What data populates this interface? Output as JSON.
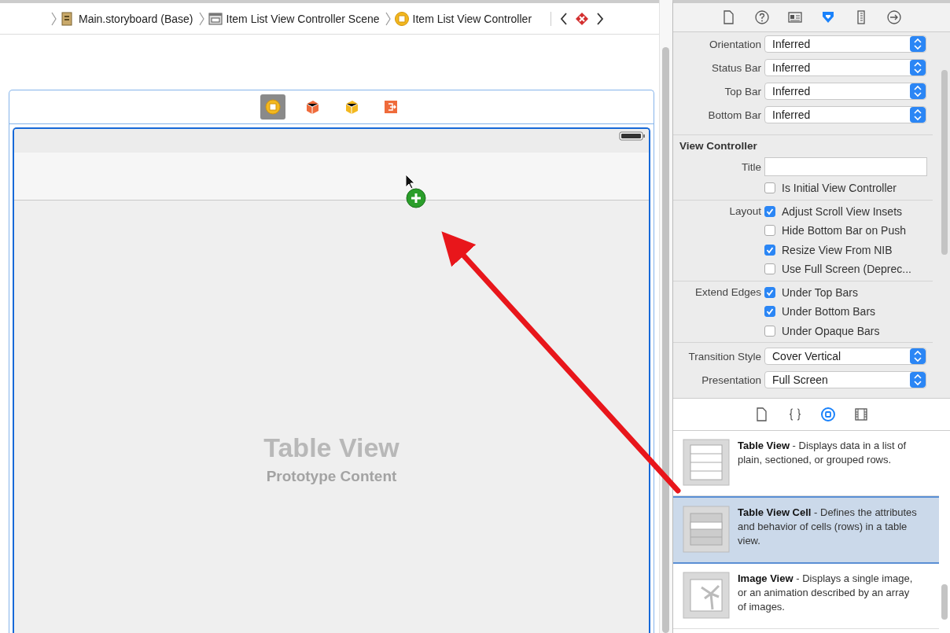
{
  "breadcrumbs": [
    {
      "label": "Main.storyboard (Base)",
      "kind": "storyboard"
    },
    {
      "label": "Item List View Controller Scene",
      "kind": "scene"
    },
    {
      "label": "Item List View Controller",
      "kind": "controller"
    }
  ],
  "scene_dock": [
    {
      "kind": "controller",
      "selected": true
    },
    {
      "kind": "first-responder",
      "selected": false
    },
    {
      "kind": "object",
      "selected": false
    },
    {
      "kind": "exit",
      "selected": false
    }
  ],
  "table_view": {
    "title": "Table View",
    "subtitle": "Prototype Content"
  },
  "inspector_tabs": [
    {
      "kind": "file",
      "selected": false
    },
    {
      "kind": "help",
      "selected": false
    },
    {
      "kind": "identity",
      "selected": false
    },
    {
      "kind": "attributes",
      "selected": true
    },
    {
      "kind": "size",
      "selected": false
    },
    {
      "kind": "connections",
      "selected": false
    }
  ],
  "bar_rows": [
    {
      "label": "Orientation",
      "value": "Inferred"
    },
    {
      "label": "Status Bar",
      "value": "Inferred"
    },
    {
      "label": "Top Bar",
      "value": "Inferred"
    },
    {
      "label": "Bottom Bar",
      "value": "Inferred"
    }
  ],
  "view_controller": {
    "heading": "View Controller",
    "title_label": "Title",
    "groups": [
      {
        "options": [
          {
            "label": "Is Initial View Controller",
            "checked": false
          }
        ]
      },
      {
        "label": "Layout",
        "options": [
          {
            "label": "Adjust Scroll View Insets",
            "checked": true
          },
          {
            "label": "Hide Bottom Bar on Push",
            "checked": false
          },
          {
            "label": "Resize View From NIB",
            "checked": true
          },
          {
            "label": "Use Full Screen (Deprec...",
            "checked": false
          }
        ]
      },
      {
        "label": "Extend Edges",
        "options": [
          {
            "label": "Under Top Bars",
            "checked": true
          },
          {
            "label": "Under Bottom Bars",
            "checked": true
          },
          {
            "label": "Under Opaque Bars",
            "checked": false
          }
        ]
      }
    ],
    "popups": [
      {
        "label": "Transition Style",
        "value": "Cover Vertical"
      },
      {
        "label": "Presentation",
        "value": "Full Screen"
      }
    ]
  },
  "library_tabs": [
    {
      "kind": "file",
      "selected": false
    },
    {
      "kind": "code",
      "selected": false
    },
    {
      "kind": "object",
      "selected": true
    },
    {
      "kind": "media",
      "selected": false
    }
  ],
  "library_items": [
    {
      "kind": "table",
      "text": "**Table View** - Displays data in a list of plain, sectioned, or grouped rows.",
      "selected": false
    },
    {
      "kind": "cell",
      "text": "**Table View Cell** - Defines the attributes and behavior of cells (rows) in a table view.",
      "selected": true
    },
    {
      "kind": "image",
      "text": "**Image View** - Displays a single image, or an animation described by an array of images.",
      "selected": false
    }
  ]
}
